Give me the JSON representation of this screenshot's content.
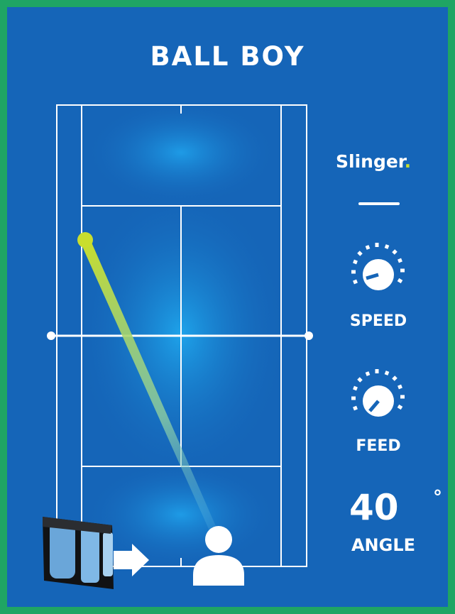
{
  "header": {
    "title": "BALL BOY"
  },
  "brand": {
    "name": "Slinger",
    "dot": "."
  },
  "controls": {
    "speed": {
      "label": "SPEED",
      "icon": "speed-dial-icon"
    },
    "feed": {
      "label": "FEED",
      "icon": "feed-dial-icon"
    },
    "angle": {
      "value": "40",
      "unit": "°",
      "label": "ANGLE"
    }
  },
  "colors": {
    "background": "#1565b8",
    "border": "#1fa564",
    "ball": "#c9de2e",
    "lines": "#ffffff"
  }
}
